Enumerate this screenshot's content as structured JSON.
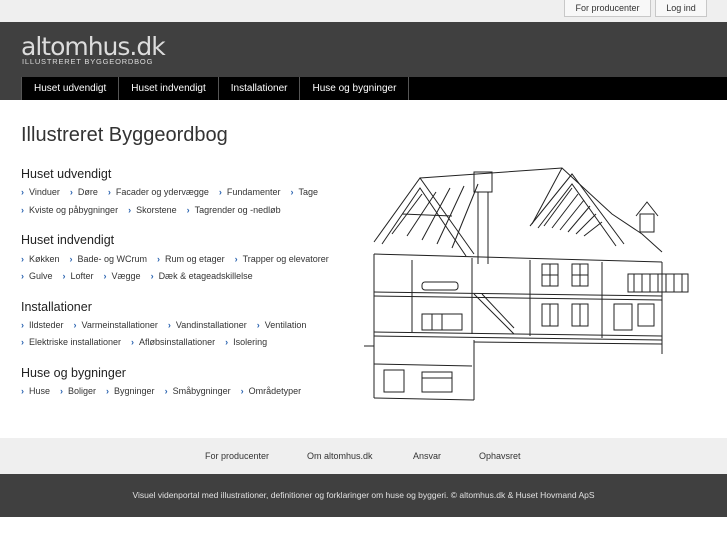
{
  "topbar": {
    "producer_label": "For producenter",
    "login_label": "Log ind"
  },
  "header": {
    "logo_text": "altomhus.dk",
    "logo_subtitle": "ILLUSTRERET BYGGEORDBOG"
  },
  "nav": {
    "items": [
      "Huset udvendigt",
      "Huset indvendigt",
      "Installationer",
      "Huse og bygninger"
    ]
  },
  "main": {
    "title": "Illustreret Byggeordbog",
    "sections": [
      {
        "heading": "Huset udvendigt",
        "rows": [
          [
            "Vinduer",
            "Døre",
            "Facader og ydervægge",
            "Fundamenter",
            "Tage"
          ],
          [
            "Kviste og påbygninger",
            "Skorstene",
            "Tagrender og -nedløb"
          ]
        ]
      },
      {
        "heading": "Huset indvendigt",
        "rows": [
          [
            "Køkken",
            "Bade- og WCrum",
            "Rum og etager",
            "Trapper og elevatorer"
          ],
          [
            "Gulve",
            "Lofter",
            "Vægge",
            "Dæk & etageadskillelse"
          ]
        ]
      },
      {
        "heading": "Installationer",
        "rows": [
          [
            "Ildsteder",
            "Varmeinstallationer",
            "Vandinstallationer",
            "Ventilation"
          ],
          [
            "Elektriske installationer",
            "Afløbsinstallationer",
            "Isolering"
          ]
        ]
      },
      {
        "heading": "Huse og bygninger",
        "rows": [
          [
            "Huse",
            "Boliger",
            "Bygninger",
            "Småbygninger",
            "Områdetyper"
          ]
        ]
      }
    ]
  },
  "footer_links": {
    "items": [
      "For producenter",
      "Om altomhus.dk",
      "Ansvar",
      "Ophavsret"
    ]
  },
  "footer": {
    "text": "Visuel videnportal med illustrationer, definitioner og forklaringer om huse og byggeri. © altomhus.dk & Huset Hovmand ApS"
  }
}
